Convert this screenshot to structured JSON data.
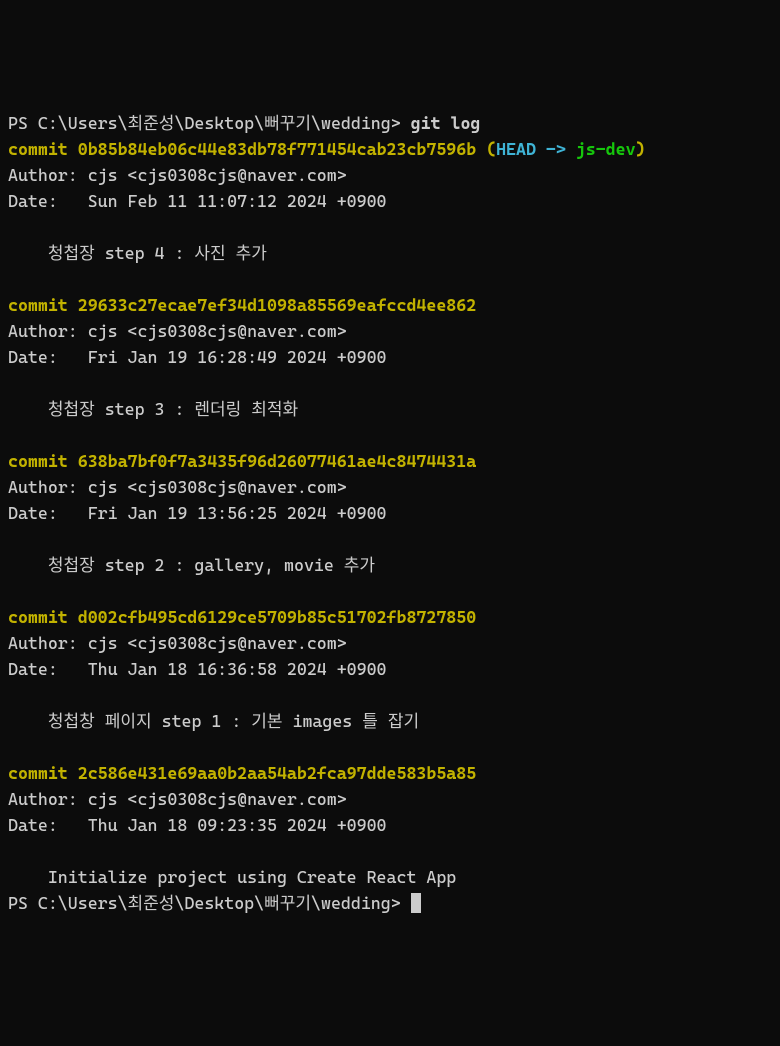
{
  "prompt1": {
    "path": "PS C:\\Users\\최준성\\Desktop\\뻐꾸기\\wedding> ",
    "command": "git log"
  },
  "commits": [
    {
      "commit_label": "commit ",
      "hash": "0b85b84eb06c44e83db78f771454cab23cb7596b",
      "ref_open": " (",
      "head": "HEAD -> ",
      "branch": "js-dev",
      "ref_close": ")",
      "author": "Author: cjs <cjs0308cjs@naver.com>",
      "date": "Date:   Sun Feb 11 11:07:12 2024 +0900",
      "message": "    청첩장 step 4 : 사진 추가"
    },
    {
      "commit_label": "commit ",
      "hash": "29633c27ecae7ef34d1098a85569eafccd4ee862",
      "author": "Author: cjs <cjs0308cjs@naver.com>",
      "date": "Date:   Fri Jan 19 16:28:49 2024 +0900",
      "message": "    청첩장 step 3 : 렌더링 최적화"
    },
    {
      "commit_label": "commit ",
      "hash": "638ba7bf0f7a3435f96d26077461ae4c8474431a",
      "author": "Author: cjs <cjs0308cjs@naver.com>",
      "date": "Date:   Fri Jan 19 13:56:25 2024 +0900",
      "message": "    청첩장 step 2 : gallery, movie 추가"
    },
    {
      "commit_label": "commit ",
      "hash": "d002cfb495cd6129ce5709b85c51702fb8727850",
      "author": "Author: cjs <cjs0308cjs@naver.com>",
      "date": "Date:   Thu Jan 18 16:36:58 2024 +0900",
      "message": "    청첩창 페이지 step 1 : 기본 images 틀 잡기"
    },
    {
      "commit_label": "commit ",
      "hash": "2c586e431e69aa0b2aa54ab2fca97dde583b5a85",
      "author": "Author: cjs <cjs0308cjs@naver.com>",
      "date": "Date:   Thu Jan 18 09:23:35 2024 +0900",
      "message": "    Initialize project using Create React App"
    }
  ],
  "prompt2": {
    "path": "PS C:\\Users\\최준성\\Desktop\\뻐꾸기\\wedding> "
  }
}
